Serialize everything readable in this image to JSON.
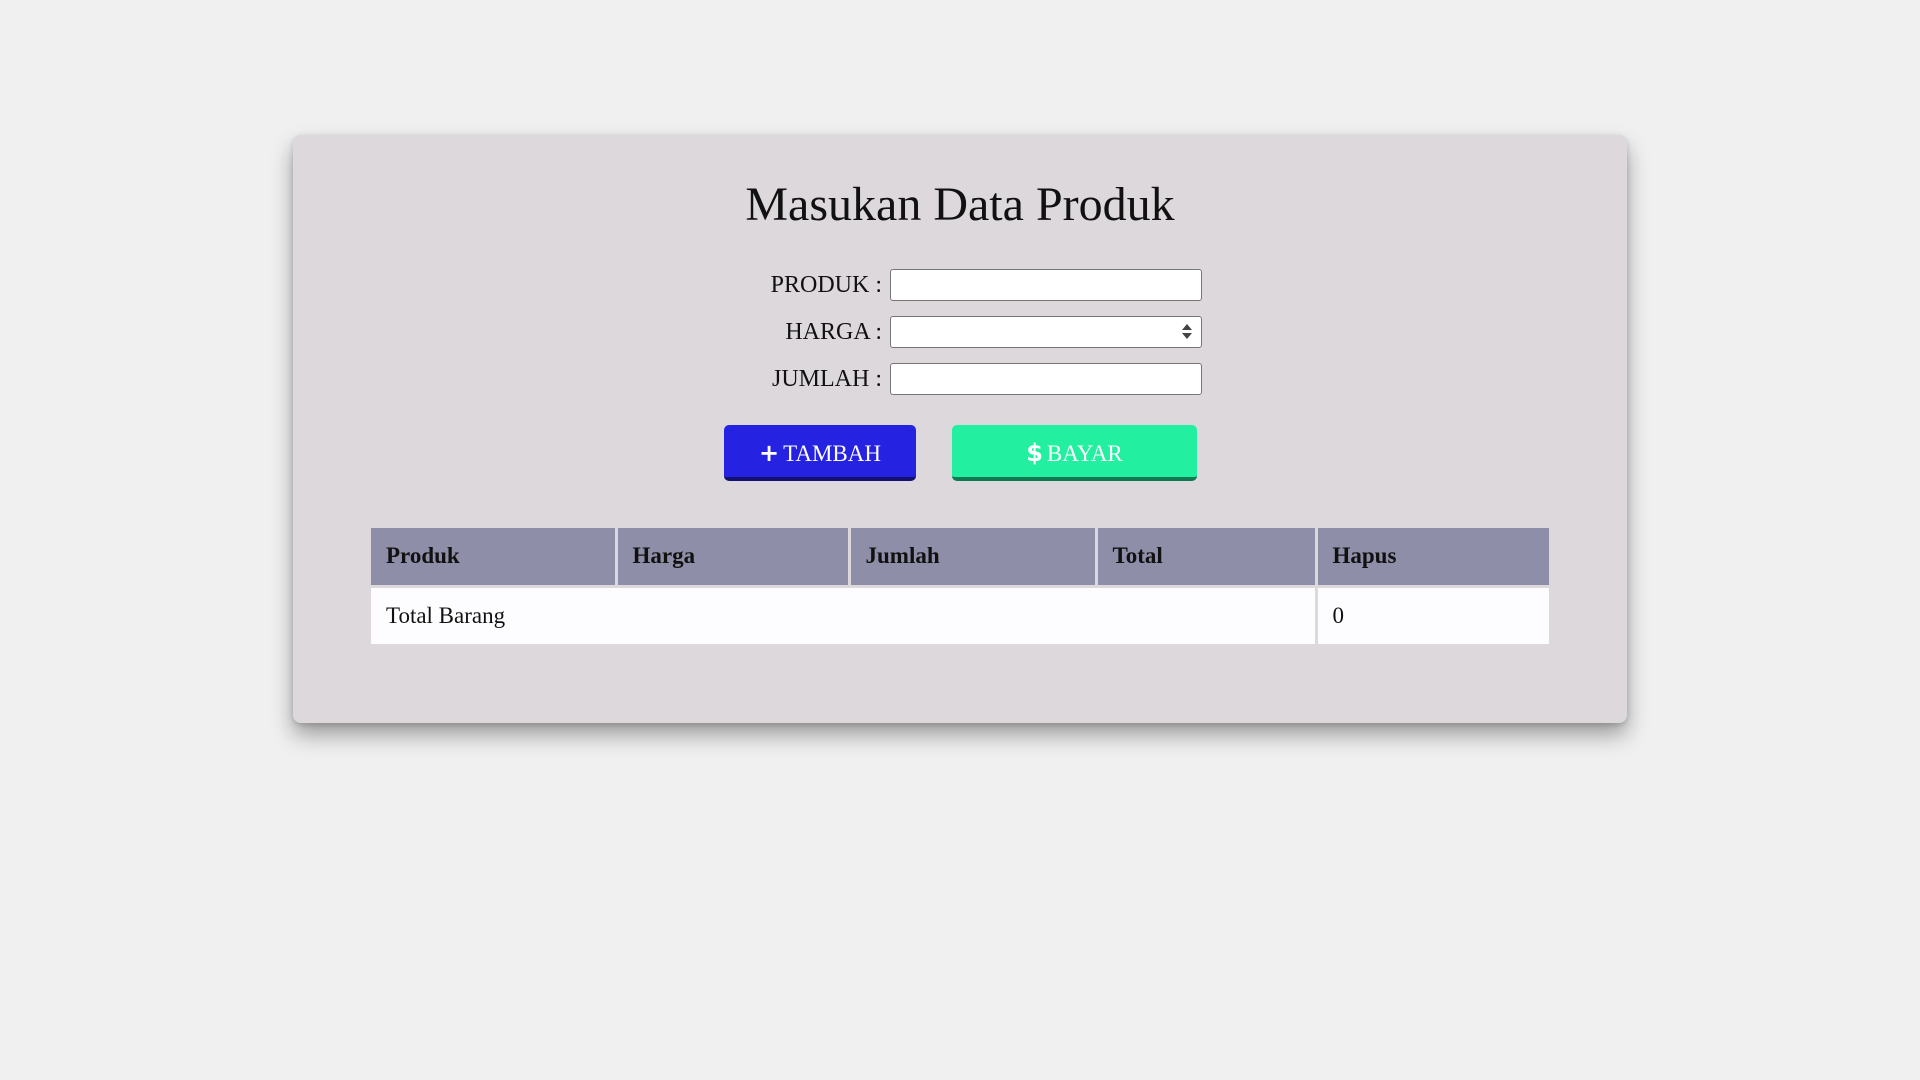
{
  "page": {
    "title": "Masukan Data Produk"
  },
  "form": {
    "produk": {
      "label": "PRODUK :",
      "value": ""
    },
    "harga": {
      "label": "HARGA :",
      "value": ""
    },
    "jumlah": {
      "label": "JUMLAH :",
      "value": ""
    }
  },
  "buttons": {
    "tambah": {
      "label": "TAMBAH",
      "icon": "plus-icon",
      "color": "#2522e2"
    },
    "bayar": {
      "label": "BAYAR",
      "icon": "dollar-icon",
      "color": "#22ef9f"
    }
  },
  "table": {
    "columns": [
      "Produk",
      "Harga",
      "Jumlah",
      "Total",
      "Hapus"
    ],
    "footer": {
      "label": "Total Barang",
      "value": "0"
    }
  },
  "colors": {
    "background": "#f0f0f0",
    "card": "#dcd8db",
    "table_header": "#8f8ea8"
  }
}
